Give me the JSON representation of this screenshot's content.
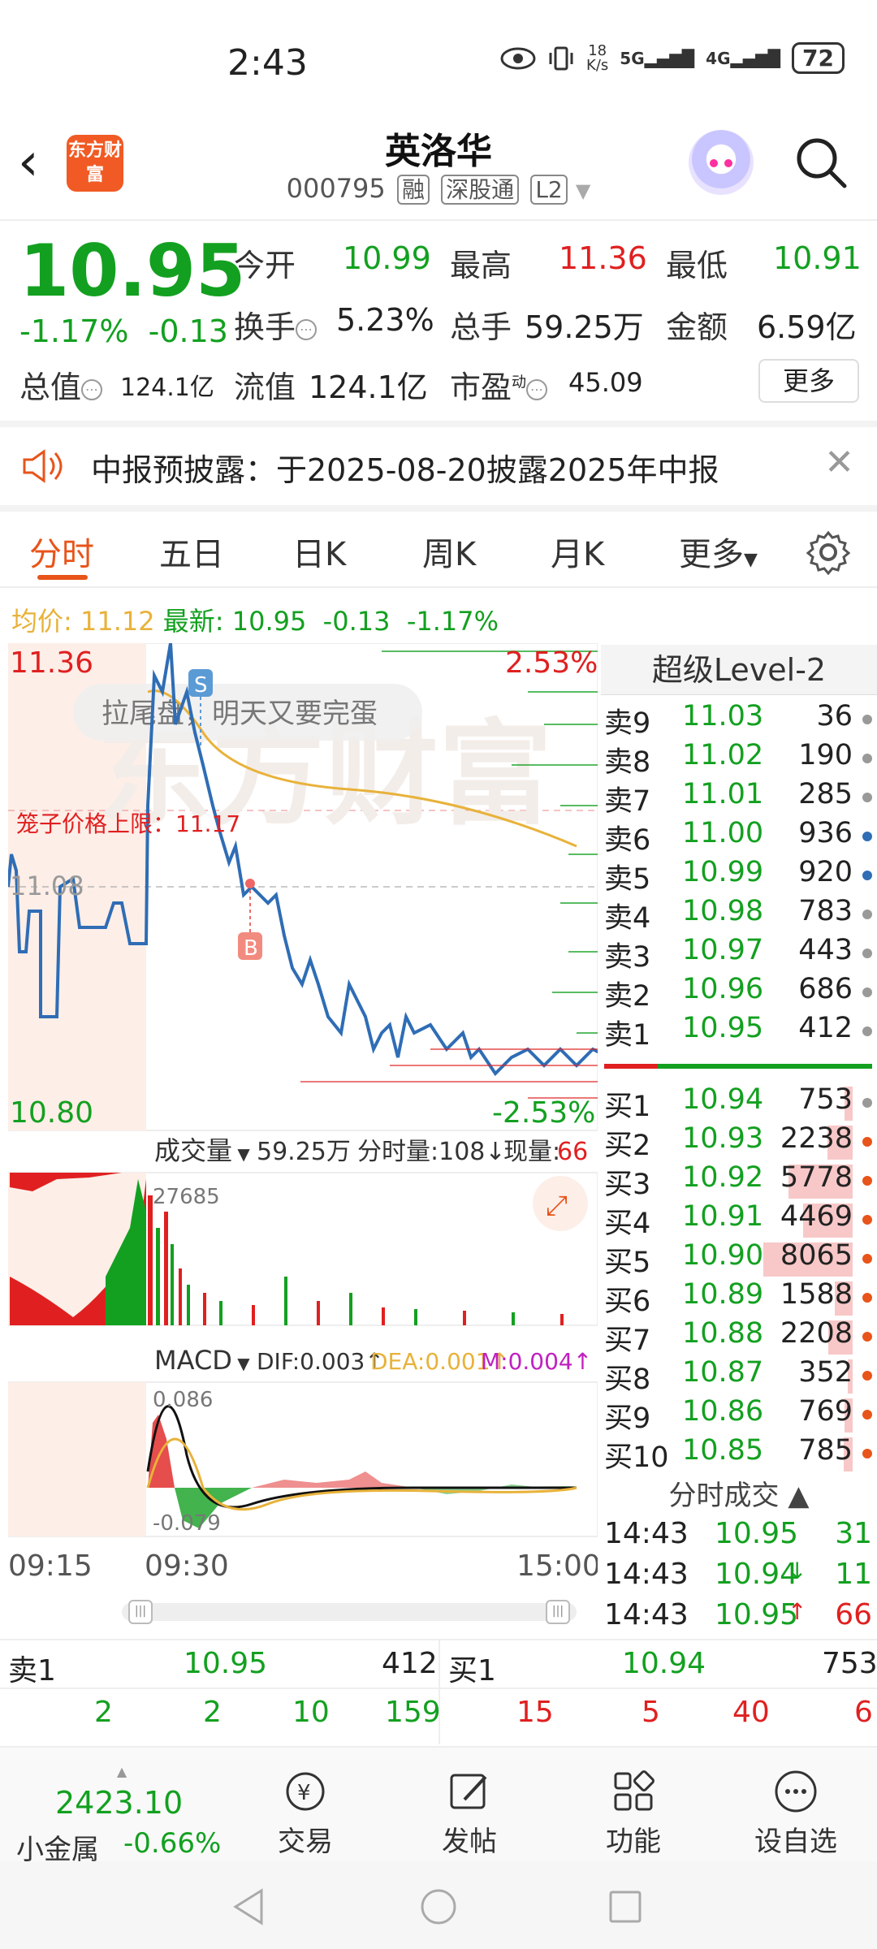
{
  "status_bar": {
    "time": "2:43",
    "speed": "18\nK/s",
    "net1": "5G",
    "net2": "4G",
    "battery": "72"
  },
  "header": {
    "title": "英洛华",
    "code": "000795",
    "tags": [
      "融",
      "深股通",
      "L2"
    ],
    "logo_text": "东方财富"
  },
  "quote": {
    "price": "10.95",
    "change_pct": "-1.17%",
    "change": "-0.13",
    "fields": [
      {
        "label": "今开",
        "value": "10.99",
        "color": "green"
      },
      {
        "label": "最高",
        "value": "11.36",
        "color": "red"
      },
      {
        "label": "最低",
        "value": "10.91",
        "color": "green"
      },
      {
        "label": "换手",
        "value": "5.23%",
        "color": "black"
      },
      {
        "label": "总手",
        "value": "59.25万",
        "color": "black"
      },
      {
        "label": "金额",
        "value": "6.59亿",
        "color": "black"
      },
      {
        "label": "总值",
        "value": "124.1亿",
        "color": "black"
      },
      {
        "label": "流值",
        "value": "124.1亿",
        "color": "black"
      },
      {
        "label": "市盈",
        "value": "45.09",
        "color": "black"
      }
    ],
    "dynamic_mark": "动",
    "more_label": "更多"
  },
  "notice": {
    "text": "中报预披露：于2025-08-20披露2025年中报"
  },
  "tabs": [
    "分时",
    "五日",
    "日K",
    "周K",
    "月K",
    "更多"
  ],
  "avg_bar": {
    "avg_label": "均价:",
    "avg_value": "11.12",
    "latest_label": "最新:",
    "latest_value": "10.95",
    "change": "-0.13",
    "pct": "-1.17%"
  },
  "chart": {
    "y_high": "11.36",
    "y_low": "10.80",
    "pct_high": "2.53%",
    "pct_low": "-2.53%",
    "ref_price": "11.08",
    "limit_label": "笼子价格上限：11.17",
    "comment": "拉尾盘，明天又要完蛋",
    "watermark": "东方财富",
    "marker_s": "S",
    "marker_b": "B",
    "volume_label": "成交量",
    "volume_total": "59.25万",
    "volume_tick": "分时量:108↓",
    "volume_now_label": "现量:",
    "volume_now": "66",
    "volume_max": "27685",
    "macd_label": "MACD",
    "dif": "DIF:0.003↑",
    "dea": "DEA:0.001↑",
    "m": "M:0.004↑",
    "macd_high": "0.086",
    "macd_low": "-0.079",
    "time_start": "09:15",
    "time_open": "09:30",
    "time_end": "15:00",
    "colors": {
      "up": "#e02020",
      "down": "#13a020",
      "price_line": "#2f6db5",
      "avg_line": "#e8b23a"
    }
  },
  "level2": {
    "title": "超级Level-2",
    "asks": [
      {
        "k": "卖9",
        "p": "11.03",
        "v": "36"
      },
      {
        "k": "卖8",
        "p": "11.02",
        "v": "190"
      },
      {
        "k": "卖7",
        "p": "11.01",
        "v": "285"
      },
      {
        "k": "卖6",
        "p": "11.00",
        "v": "936"
      },
      {
        "k": "卖5",
        "p": "10.99",
        "v": "920"
      },
      {
        "k": "卖4",
        "p": "10.98",
        "v": "783"
      },
      {
        "k": "卖3",
        "p": "10.97",
        "v": "443"
      },
      {
        "k": "卖2",
        "p": "10.96",
        "v": "686"
      },
      {
        "k": "卖1",
        "p": "10.95",
        "v": "412"
      }
    ],
    "bids": [
      {
        "k": "买1",
        "p": "10.94",
        "v": "753"
      },
      {
        "k": "买2",
        "p": "10.93",
        "v": "2238"
      },
      {
        "k": "买3",
        "p": "10.92",
        "v": "5778"
      },
      {
        "k": "买4",
        "p": "10.91",
        "v": "4469"
      },
      {
        "k": "买5",
        "p": "10.90",
        "v": "8065"
      },
      {
        "k": "买6",
        "p": "10.89",
        "v": "1588"
      },
      {
        "k": "买7",
        "p": "10.88",
        "v": "2208"
      },
      {
        "k": "买8",
        "p": "10.87",
        "v": "352"
      },
      {
        "k": "买9",
        "p": "10.86",
        "v": "769"
      },
      {
        "k": "买10",
        "p": "10.85",
        "v": "785"
      }
    ],
    "ticks_title": "分时成交",
    "ticks": [
      {
        "t": "14:43",
        "p": "10.95",
        "arrow": "",
        "v": "31",
        "vc": "green"
      },
      {
        "t": "14:43",
        "p": "10.94",
        "arrow": "↓",
        "v": "11",
        "vc": "green"
      },
      {
        "t": "14:43",
        "p": "10.95",
        "arrow": "↑",
        "v": "66",
        "vc": "red"
      }
    ]
  },
  "summary": {
    "sell1_label": "卖1",
    "sell1_price": "10.95",
    "sell1_vol": "412",
    "buy1_label": "买1",
    "buy1_price": "10.94",
    "buy1_vol": "753",
    "sell_breakdown": [
      "2",
      "2",
      "10",
      "159"
    ],
    "buy_breakdown": [
      "15",
      "5",
      "40",
      "6"
    ]
  },
  "bottom_nav": {
    "index_value": "2423.10",
    "index_name": "小金属",
    "index_pct": "-0.66%",
    "items": [
      "交易",
      "发帖",
      "功能",
      "设自选"
    ]
  }
}
